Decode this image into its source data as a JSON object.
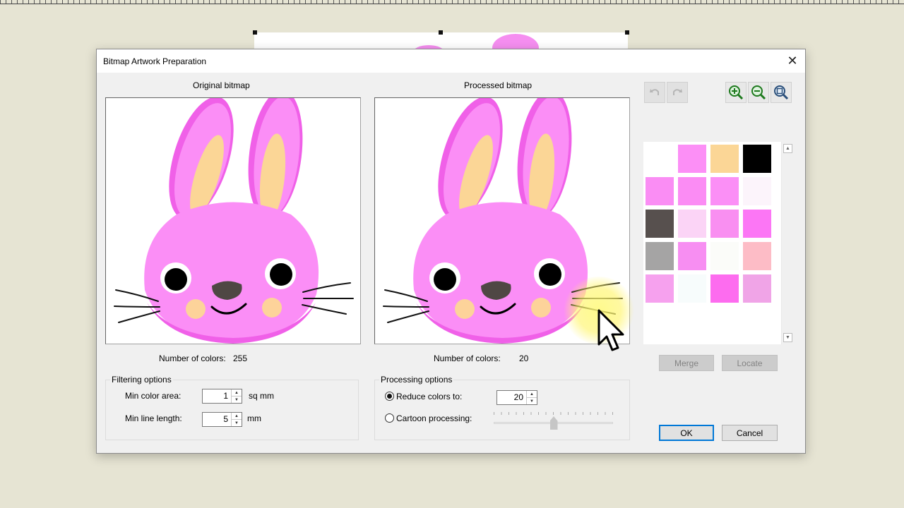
{
  "window": {
    "title": "Bitmap Artwork Preparation",
    "close_glyph": "✕"
  },
  "original": {
    "heading": "Original bitmap",
    "colors_label": "Number of colors:",
    "colors_value": "255"
  },
  "processed": {
    "heading": "Processed bitmap",
    "colors_label": "Number of colors:",
    "colors_value": "20"
  },
  "filtering": {
    "title": "Filtering options",
    "min_color_area": {
      "label": "Min color area:",
      "value": "1",
      "unit": "sq mm"
    },
    "min_line_length": {
      "label": "Min line length:",
      "value": "5",
      "unit": "mm"
    }
  },
  "processing": {
    "title": "Processing options",
    "reduce": {
      "label": "Reduce colors to:",
      "value": "20",
      "selected": true
    },
    "cartoon": {
      "label": "Cartoon processing:",
      "selected": false,
      "level": 0.5
    }
  },
  "toolbar": {
    "undo_icon": "undo-icon",
    "redo_icon": "redo-icon",
    "zoom_in_icon": "zoom-in-icon",
    "zoom_out_icon": "zoom-out-icon",
    "zoom_fit_icon": "zoom-fit-icon"
  },
  "palette": [
    "#ffffff",
    "#fc8ff6",
    "#fbd696",
    "#000000",
    "#fa8df4",
    "#fb8cf4",
    "#fb8ff6",
    "#fcf4fb",
    "#57504e",
    "#fbd4f6",
    "#f98ff1",
    "#fc76f5",
    "#a5a4a4",
    "#f78ef2",
    "#fbfcf9",
    "#fdbcc6",
    "#f6a1ee",
    "#f7fcfc",
    "#fd6cef",
    "#f0a4e7"
  ],
  "buttons": {
    "merge": "Merge",
    "locate": "Locate",
    "ok": "OK",
    "cancel": "Cancel"
  },
  "colors": {
    "bunny_pink": "#fb8ef6",
    "bunny_outline": "#f060e8",
    "ear_inner": "#fbd696",
    "cheek": "#fdd39a",
    "nose": "#4f4744",
    "accent": "#0078d7"
  }
}
